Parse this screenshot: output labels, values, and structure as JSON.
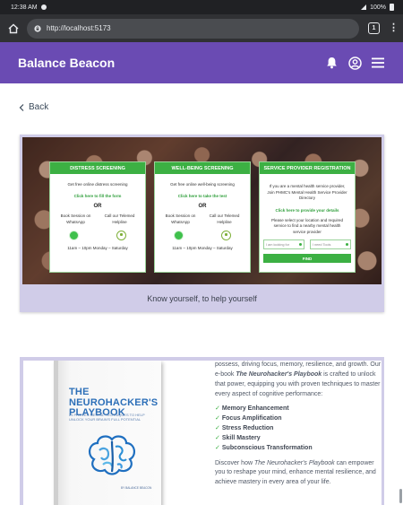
{
  "status_bar": {
    "time": "12:38 AM",
    "battery": "100%"
  },
  "browser": {
    "url": "http://localhost:5173",
    "tab_count": "1"
  },
  "header": {
    "brand": "Balance Beacon"
  },
  "back_link": {
    "label": "Back"
  },
  "services": [
    {
      "title": "DISTRESS SCREENING",
      "description": "Get free online distress screening",
      "link": "Click here to fill the form",
      "or": "OR",
      "option_left": "Book Session on WhatsApp",
      "option_right": "Call our Telemed Helpline",
      "hours": "11am – 10pm Monday – Saturday"
    },
    {
      "title": "WELL-BEING SCREENING",
      "description": "Get free online well-being screening",
      "link": "Click here to take the test",
      "or": "OR",
      "option_left": "Book Session on WhatsApp",
      "option_right": "Call our Telemed Helpline",
      "hours": "11am – 10pm Monday – Saturday"
    }
  ],
  "provider": {
    "title": "SERVICE PROVIDER REGISTRATION",
    "description": "If you are a mental health service provider, Join PHMC's Mental Health Service Provider Directory",
    "link": "Click here to provide your details",
    "select_text": "Please select your location and required service to find a nearby mental health service provider",
    "field_location": "I am looking for",
    "field_service": "I need Tools",
    "find_label": "FIND"
  },
  "banner_caption": "Know yourself, to help yourself",
  "book": {
    "cover_title": "THE NEUROHACKER'S PLAYBOOK",
    "cover_subtitle": "21 PROVEN MENTAL TECHNIQUES TO HELP UNLOCK YOUR BRAIN'S FULL POTENTIAL",
    "cover_author": "BY BALANCE BEACON",
    "intro": "possess, driving focus, memory, resilience, and growth. Our e-book ",
    "intro_title": "The Neurohacker's Playbook",
    "intro_rest": " is crafted to unlock that power, equipping you with proven techniques to master every aspect of cognitive performance:",
    "features": [
      "Memory Enhancement",
      "Focus Amplification",
      "Stress Reduction",
      "Skill Mastery",
      "Subconscious Transformation"
    ],
    "outro_start": "Discover how ",
    "outro_title": "The Neurohacker's Playbook",
    "outro_rest": " can empower you to reshape your mind, enhance mental resilience, and achieve mastery in every area of your life."
  },
  "colors": {
    "header": "#6a4bb3",
    "accent_green": "#3cb043",
    "card_frame": "#d0cce8"
  },
  "icons": [
    "home-icon",
    "lock-icon",
    "bell-icon",
    "user-circle-icon",
    "menu-icon",
    "chevron-left-icon",
    "whatsapp-icon",
    "phone-icon",
    "brain-icon"
  ]
}
